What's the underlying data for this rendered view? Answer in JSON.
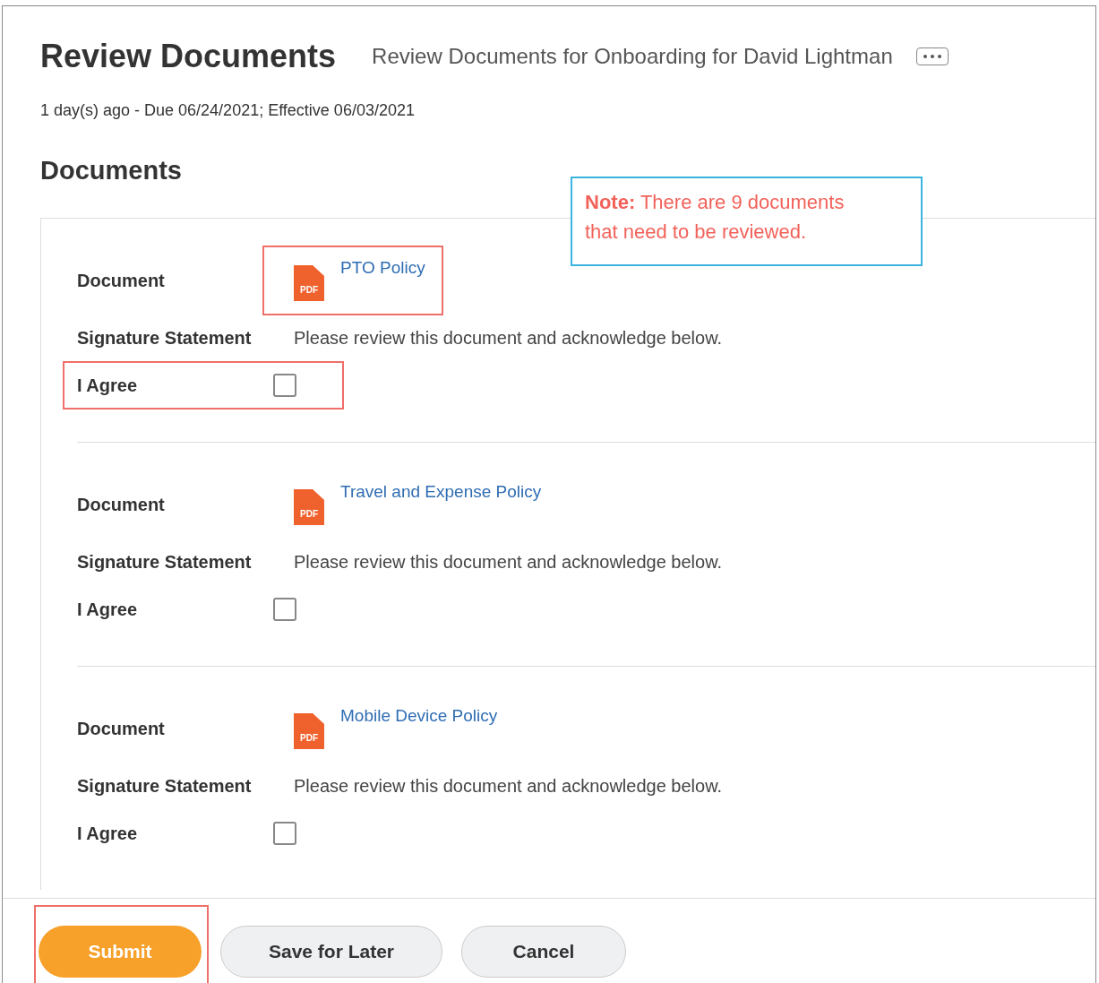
{
  "header": {
    "title": "Review Documents",
    "subtitle": "Review Documents for Onboarding for David Lightman",
    "meta": "1 day(s) ago - Due 06/24/2021; Effective 06/03/2021"
  },
  "section_title": "Documents",
  "note": "**Note:** There are 9 documents that need to be reviewed.",
  "documents": [
    {
      "document_label": "Document",
      "file_badge": "PDF",
      "file_name": "PTO Policy",
      "file_highlighted": true,
      "statement_label": "Signature Statement",
      "statement": "Please review this document and acknowledge below.",
      "agree_label": "I Agree",
      "checked": false,
      "agree_highlighted": true
    },
    {
      "document_label": "Document",
      "file_badge": "PDF",
      "file_name": "Travel and Expense Policy",
      "file_highlighted": false,
      "statement_label": "Signature Statement",
      "statement": "Please review this document and acknowledge below.",
      "agree_label": "I Agree",
      "checked": false,
      "agree_highlighted": false
    },
    {
      "document_label": "Document",
      "file_badge": "PDF",
      "file_name": "Mobile Device Policy",
      "file_highlighted": false,
      "statement_label": "Signature Statement",
      "statement": "Please review this document and acknowledge below.",
      "agree_label": "I Agree",
      "checked": false,
      "agree_highlighted": false
    }
  ],
  "buttons": [
    {
      "label": "Submit",
      "kind": "primary",
      "highlighted": true
    },
    {
      "label": "Save for Later",
      "kind": "secondary",
      "highlighted": false
    },
    {
      "label": "Cancel",
      "kind": "secondary",
      "highlighted": false
    }
  ]
}
